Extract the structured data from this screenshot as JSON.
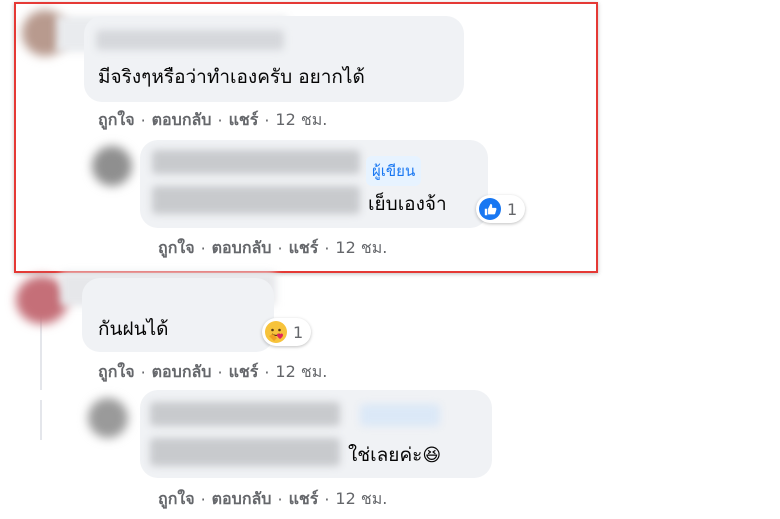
{
  "colors": {
    "highlight_border": "#e53935",
    "bubble_bg": "#f0f2f5",
    "action_text": "#65676b",
    "author_badge_bg": "#e7f3ff",
    "author_badge_text": "#1877f2",
    "like_blue": "#1877f2"
  },
  "comments": [
    {
      "text": "มีจริงๆหรือว่าทำเองครับ อยากได้",
      "actions": {
        "like": "ถูกใจ",
        "reply": "ตอบกลับ",
        "share": "แชร์",
        "time": "12 ชม."
      }
    },
    {
      "text": "เย็บเองจ้า",
      "author_badge": "ผู้เขียน",
      "reaction": {
        "icon": "like-icon",
        "count": "1"
      },
      "actions": {
        "like": "ถูกใจ",
        "reply": "ตอบกลับ",
        "share": "แชร์",
        "time": "12 ชม."
      }
    },
    {
      "text": "กันฝนได้",
      "reaction": {
        "icon": "care-emoji-icon",
        "count": "1"
      },
      "actions": {
        "like": "ถูกใจ",
        "reply": "ตอบกลับ",
        "share": "แชร์",
        "time": "12 ชม."
      }
    },
    {
      "text": "ใช่เลยค่ะ",
      "emoji": "😆",
      "actions": {
        "like": "ถูกใจ",
        "reply": "ตอบกลับ",
        "share": "แชร์",
        "time": "12 ชม."
      }
    }
  ],
  "separator": "·"
}
